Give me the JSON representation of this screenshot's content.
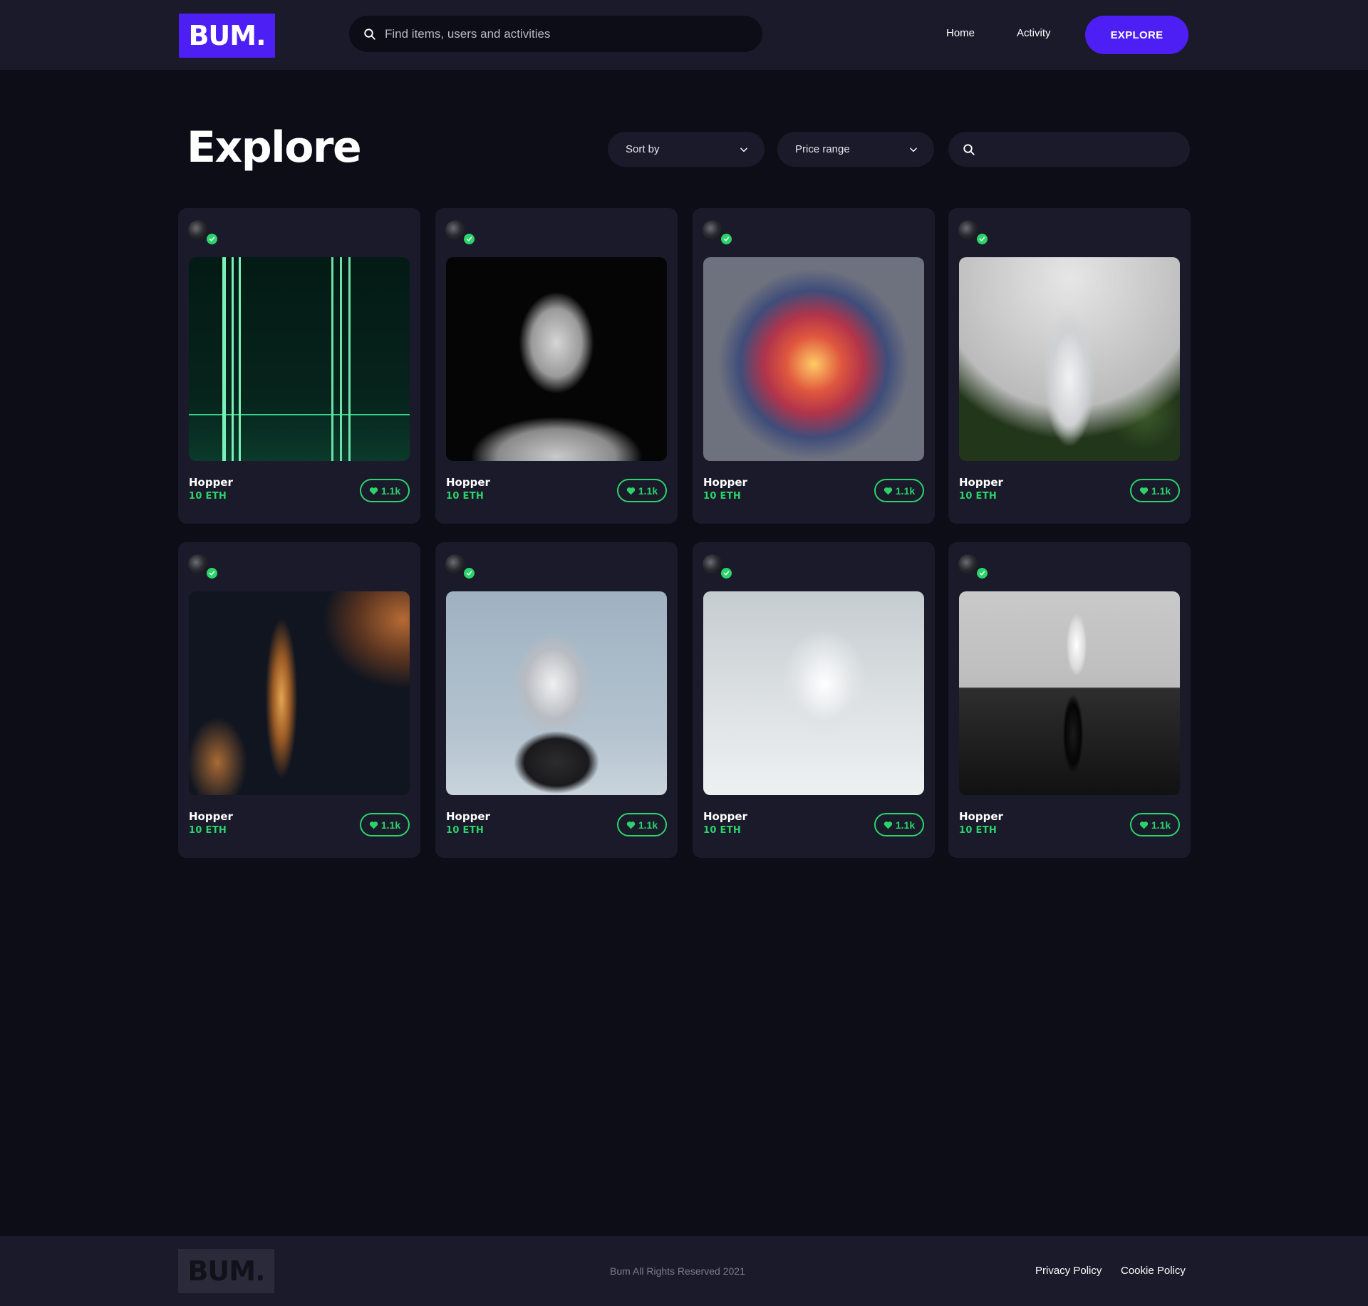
{
  "header": {
    "logo": "BUM.",
    "search_placeholder": "Find items, users and activities",
    "nav": {
      "home": "Home",
      "activity": "Activity"
    },
    "explore_button": "EXPLORE"
  },
  "page": {
    "title": "Explore",
    "filters": {
      "sort_by": "Sort by",
      "price_range": "Price range"
    }
  },
  "cards": [
    {
      "name": "Hopper",
      "price": "10 ETH",
      "likes": "1.1k",
      "art": "neon-corridor"
    },
    {
      "name": "Hopper",
      "price": "10 ETH",
      "likes": "1.1k",
      "art": "statue-bust"
    },
    {
      "name": "Hopper",
      "price": "10 ETH",
      "likes": "1.1k",
      "art": "voxel-cube"
    },
    {
      "name": "Hopper",
      "price": "10 ETH",
      "likes": "1.1k",
      "art": "astronaut"
    },
    {
      "name": "Hopper",
      "price": "10 ETH",
      "likes": "1.1k",
      "art": "dna-helix"
    },
    {
      "name": "Hopper",
      "price": "10 ETH",
      "likes": "1.1k",
      "art": "white-robot"
    },
    {
      "name": "Hopper",
      "price": "10 ETH",
      "likes": "1.1k",
      "art": "white-skull"
    },
    {
      "name": "Hopper",
      "price": "10 ETH",
      "likes": "1.1k",
      "art": "mirrored-figure"
    }
  ],
  "footer": {
    "logo": "BUM.",
    "copyright": "Bum All Rights Reserved 2021",
    "privacy": "Privacy Policy",
    "cookie": "Cookie Policy"
  },
  "colors": {
    "brand": "#4d1ff5",
    "accent_green": "#2bd46a",
    "background": "#0d0d17",
    "surface": "#1a1a2a"
  }
}
